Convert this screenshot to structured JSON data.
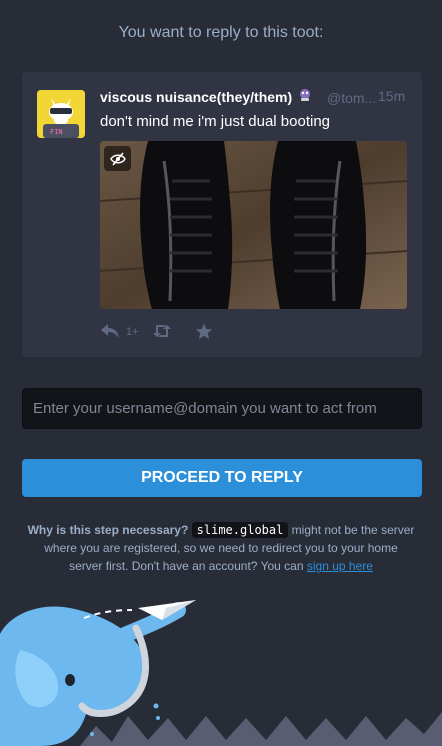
{
  "page": {
    "heading": "You want to reply to this toot:"
  },
  "status": {
    "display_name": "viscous nuisance(they/them)",
    "acct": "@tom...",
    "relative_time": "15m",
    "content": "don't mind me i'm just dual booting",
    "reply_count": "1+",
    "avatar_label": "FIN"
  },
  "form": {
    "username_placeholder": "Enter your username@domain you want to act from",
    "proceed_label": "PROCEED TO REPLY"
  },
  "hint": {
    "lead": "Why is this step necessary?",
    "domain": "slime.global",
    "body": " might not be the server where you are registered, so we need to redirect you to your home server first. Don't have an account? You can ",
    "signup_link": "sign up here"
  },
  "colors": {
    "background": "#282c37",
    "card": "#313543",
    "accent": "#2b90d9",
    "muted": "#606984"
  }
}
